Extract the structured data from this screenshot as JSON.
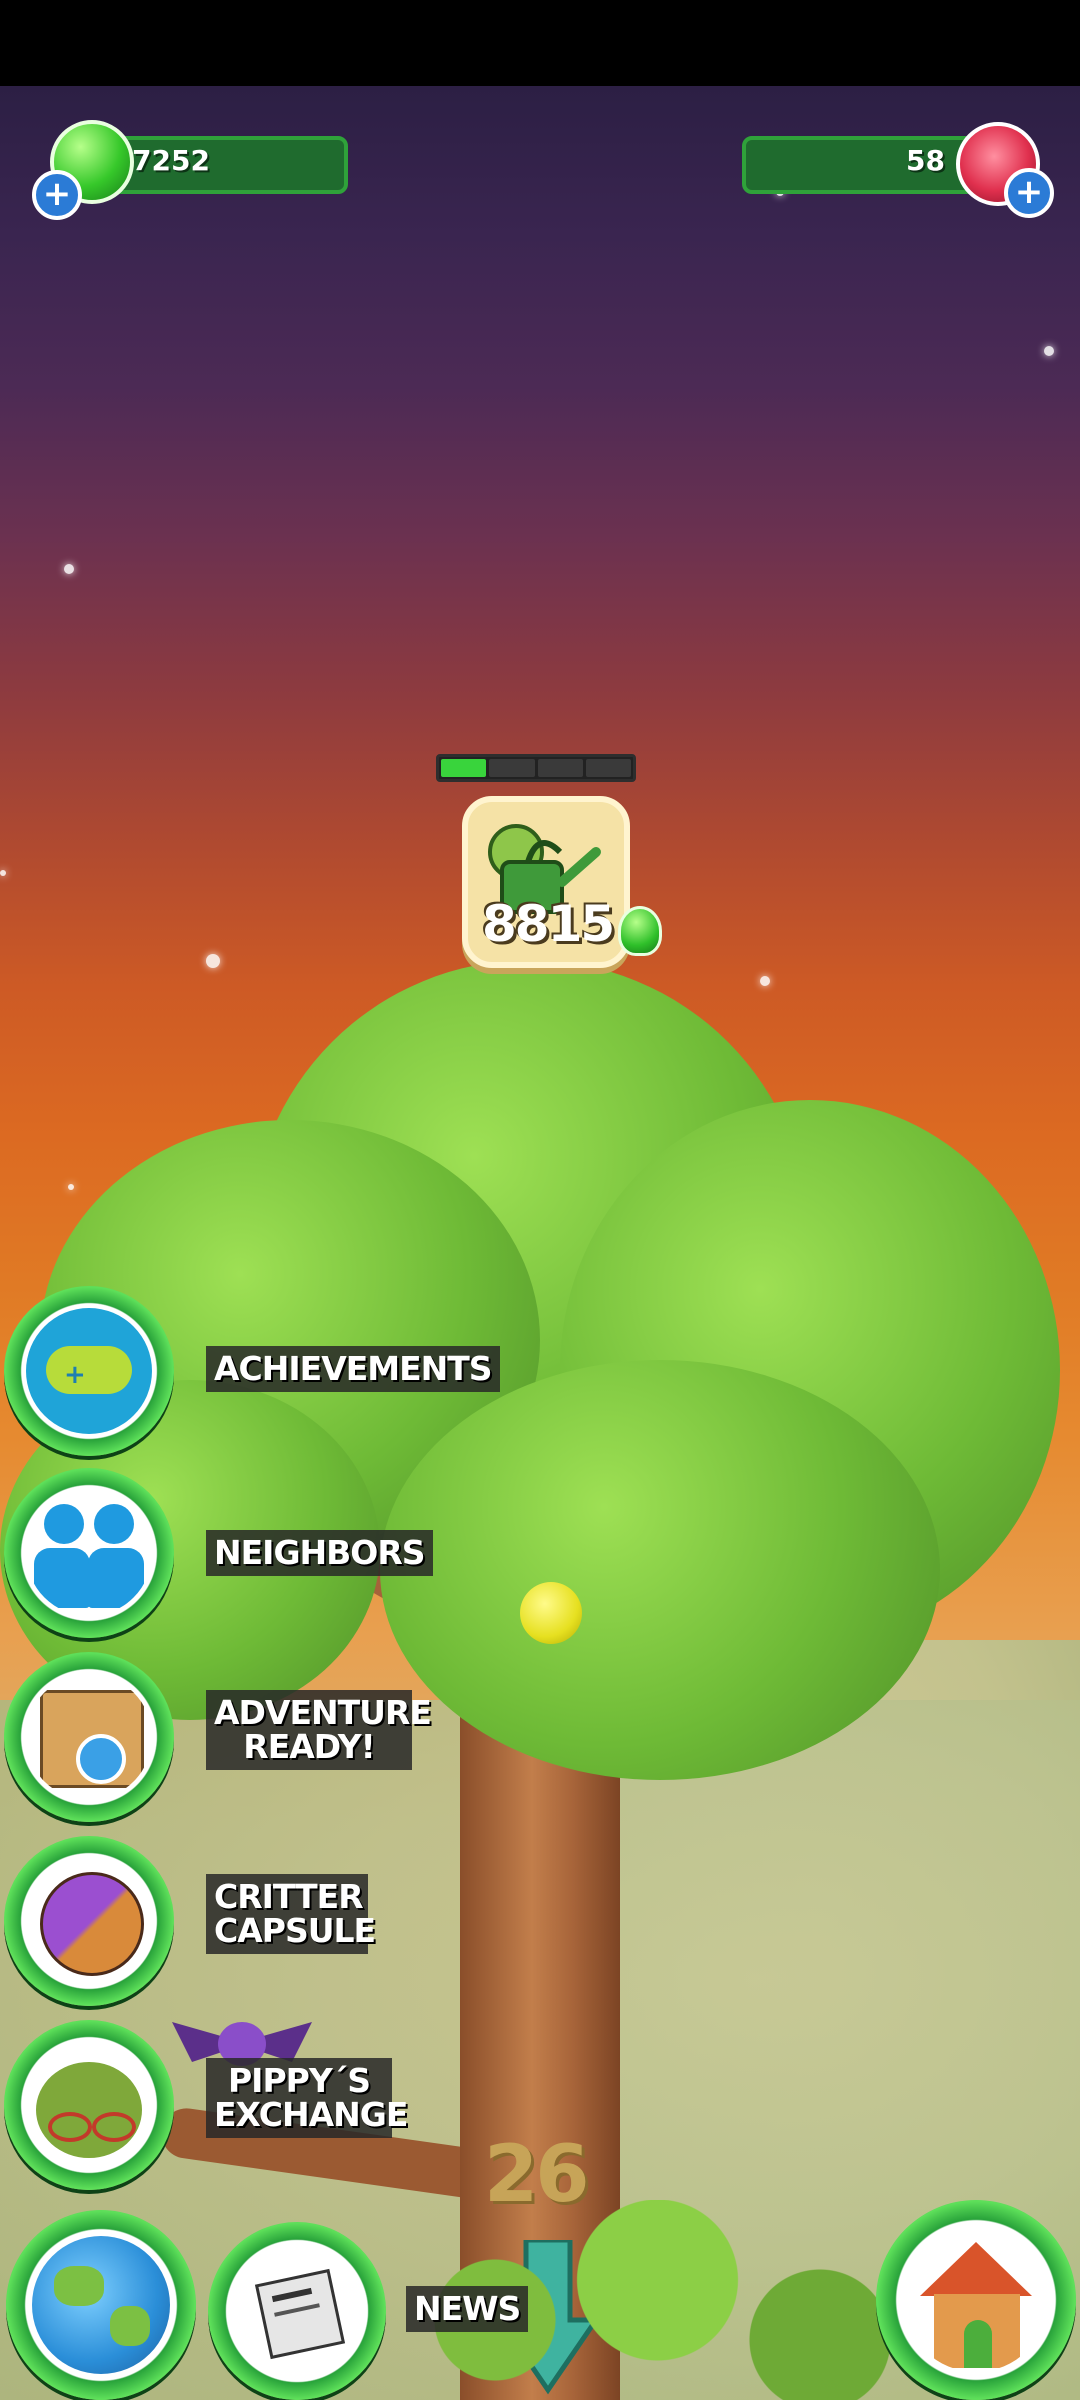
{
  "currency": {
    "slime_amount": "7252",
    "gem_amount": "58"
  },
  "upgrade": {
    "progress_fraction": 0.25,
    "watering_cost": "8815"
  },
  "menu": {
    "achievements": "ACHIEVEMENTS",
    "neighbors": "NEIGHBORS",
    "adventure_line1": "ADVENTURE",
    "adventure_line2": "READY!",
    "critter_line1": "CRITTER",
    "critter_line2": "CAPSULE",
    "pippy_line1": "PIPPY´S",
    "pippy_line2": "EXCHANGE",
    "news": "NEWS"
  },
  "tree": {
    "level": "26"
  },
  "icons": {
    "slime": "green-slime-icon",
    "gem": "red-gem-icon",
    "plus": "plus-icon",
    "achievements": "gamepad-icon",
    "neighbors": "two-people-icon",
    "adventure": "map-compass-icon",
    "critter": "capsule-icon",
    "pippy": "pippy-creature-icon",
    "world": "globe-icon",
    "news": "newspaper-icon",
    "home": "house-icon",
    "arrow": "down-arrow-icon",
    "watering": "watering-can-icon"
  },
  "colors": {
    "accent_green": "#2fa23a",
    "progress_fill": "#39d43c"
  }
}
